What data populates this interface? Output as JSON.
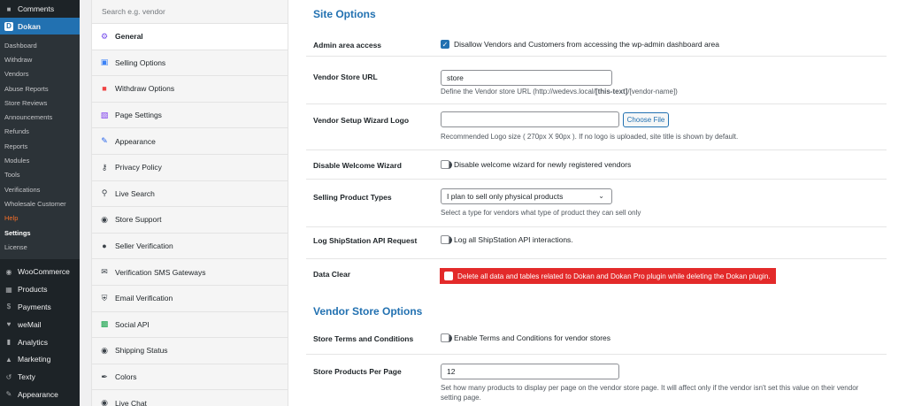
{
  "wp_sidebar": {
    "top_item": "Comments",
    "dokan": {
      "icon_letter": "D",
      "label": "Dokan"
    },
    "submenu": [
      "Dashboard",
      "Withdraw",
      "Vendors",
      "Abuse Reports",
      "Store Reviews",
      "Announcements",
      "Refunds",
      "Reports",
      "Modules",
      "Tools",
      "Verifications",
      "Wholesale Customer",
      "Help",
      "Settings",
      "License"
    ],
    "main_items": [
      "WooCommerce",
      "Products",
      "Payments",
      "weMail",
      "Analytics",
      "Marketing",
      "Texty",
      "Appearance"
    ]
  },
  "settings_nav": {
    "search_placeholder": "Search e.g. vendor",
    "tabs": [
      "General",
      "Selling Options",
      "Withdraw Options",
      "Page Settings",
      "Appearance",
      "Privacy Policy",
      "Live Search",
      "Store Support",
      "Seller Verification",
      "Verification SMS Gateways",
      "Email Verification",
      "Social API",
      "Shipping Status",
      "Colors",
      "Live Chat"
    ]
  },
  "site_options": {
    "title": "Site Options",
    "admin_area": {
      "label": "Admin area access",
      "text": "Disallow Vendors and Customers from accessing the wp-admin dashboard area",
      "checked": true
    },
    "store_url": {
      "label": "Vendor Store URL",
      "value": "store",
      "desc_pre": "Define the Vendor store URL (http://wedevs.local/",
      "desc_bold": "[this-text]",
      "desc_post": "/[vendor-name])"
    },
    "wizard_logo": {
      "label": "Vendor Setup Wizard Logo",
      "value": "",
      "button": "Choose File",
      "desc": "Recommended Logo size ( 270px X 90px ). If no logo is uploaded, site title is shown by default."
    },
    "welcome_wizard": {
      "label": "Disable Welcome Wizard",
      "help": "?",
      "text": "Disable welcome wizard for newly registered vendors"
    },
    "product_types": {
      "label": "Selling Product Types",
      "selected": "I plan to sell only physical products",
      "desc": "Select a type for vendors what type of product they can sell only"
    },
    "shipstation": {
      "label": "Log ShipStation API Request",
      "help": "?",
      "text": "Log all ShipStation API interactions."
    },
    "data_clear": {
      "label": "Data Clear",
      "help": "?",
      "text": "Delete all data and tables related to Dokan and Dokan Pro plugin while deleting the Dokan plugin."
    }
  },
  "vendor_store_options": {
    "title": "Vendor Store Options",
    "terms": {
      "label": "Store Terms and Conditions",
      "help": "?",
      "text": "Enable Terms and Conditions for vendor stores"
    },
    "per_page": {
      "label": "Store Products Per Page",
      "help": "?",
      "value": "12",
      "desc_line1": "Set how many products to display per page on the vendor store page. It will affect only if the vendor isn't set this value on their vendor",
      "desc_line2": "setting page."
    }
  },
  "colors": {
    "wp_dark": "#1d2327",
    "wp_blue": "#2271b1",
    "danger_red": "#e32a2a",
    "help_orange": "#f56e28"
  }
}
